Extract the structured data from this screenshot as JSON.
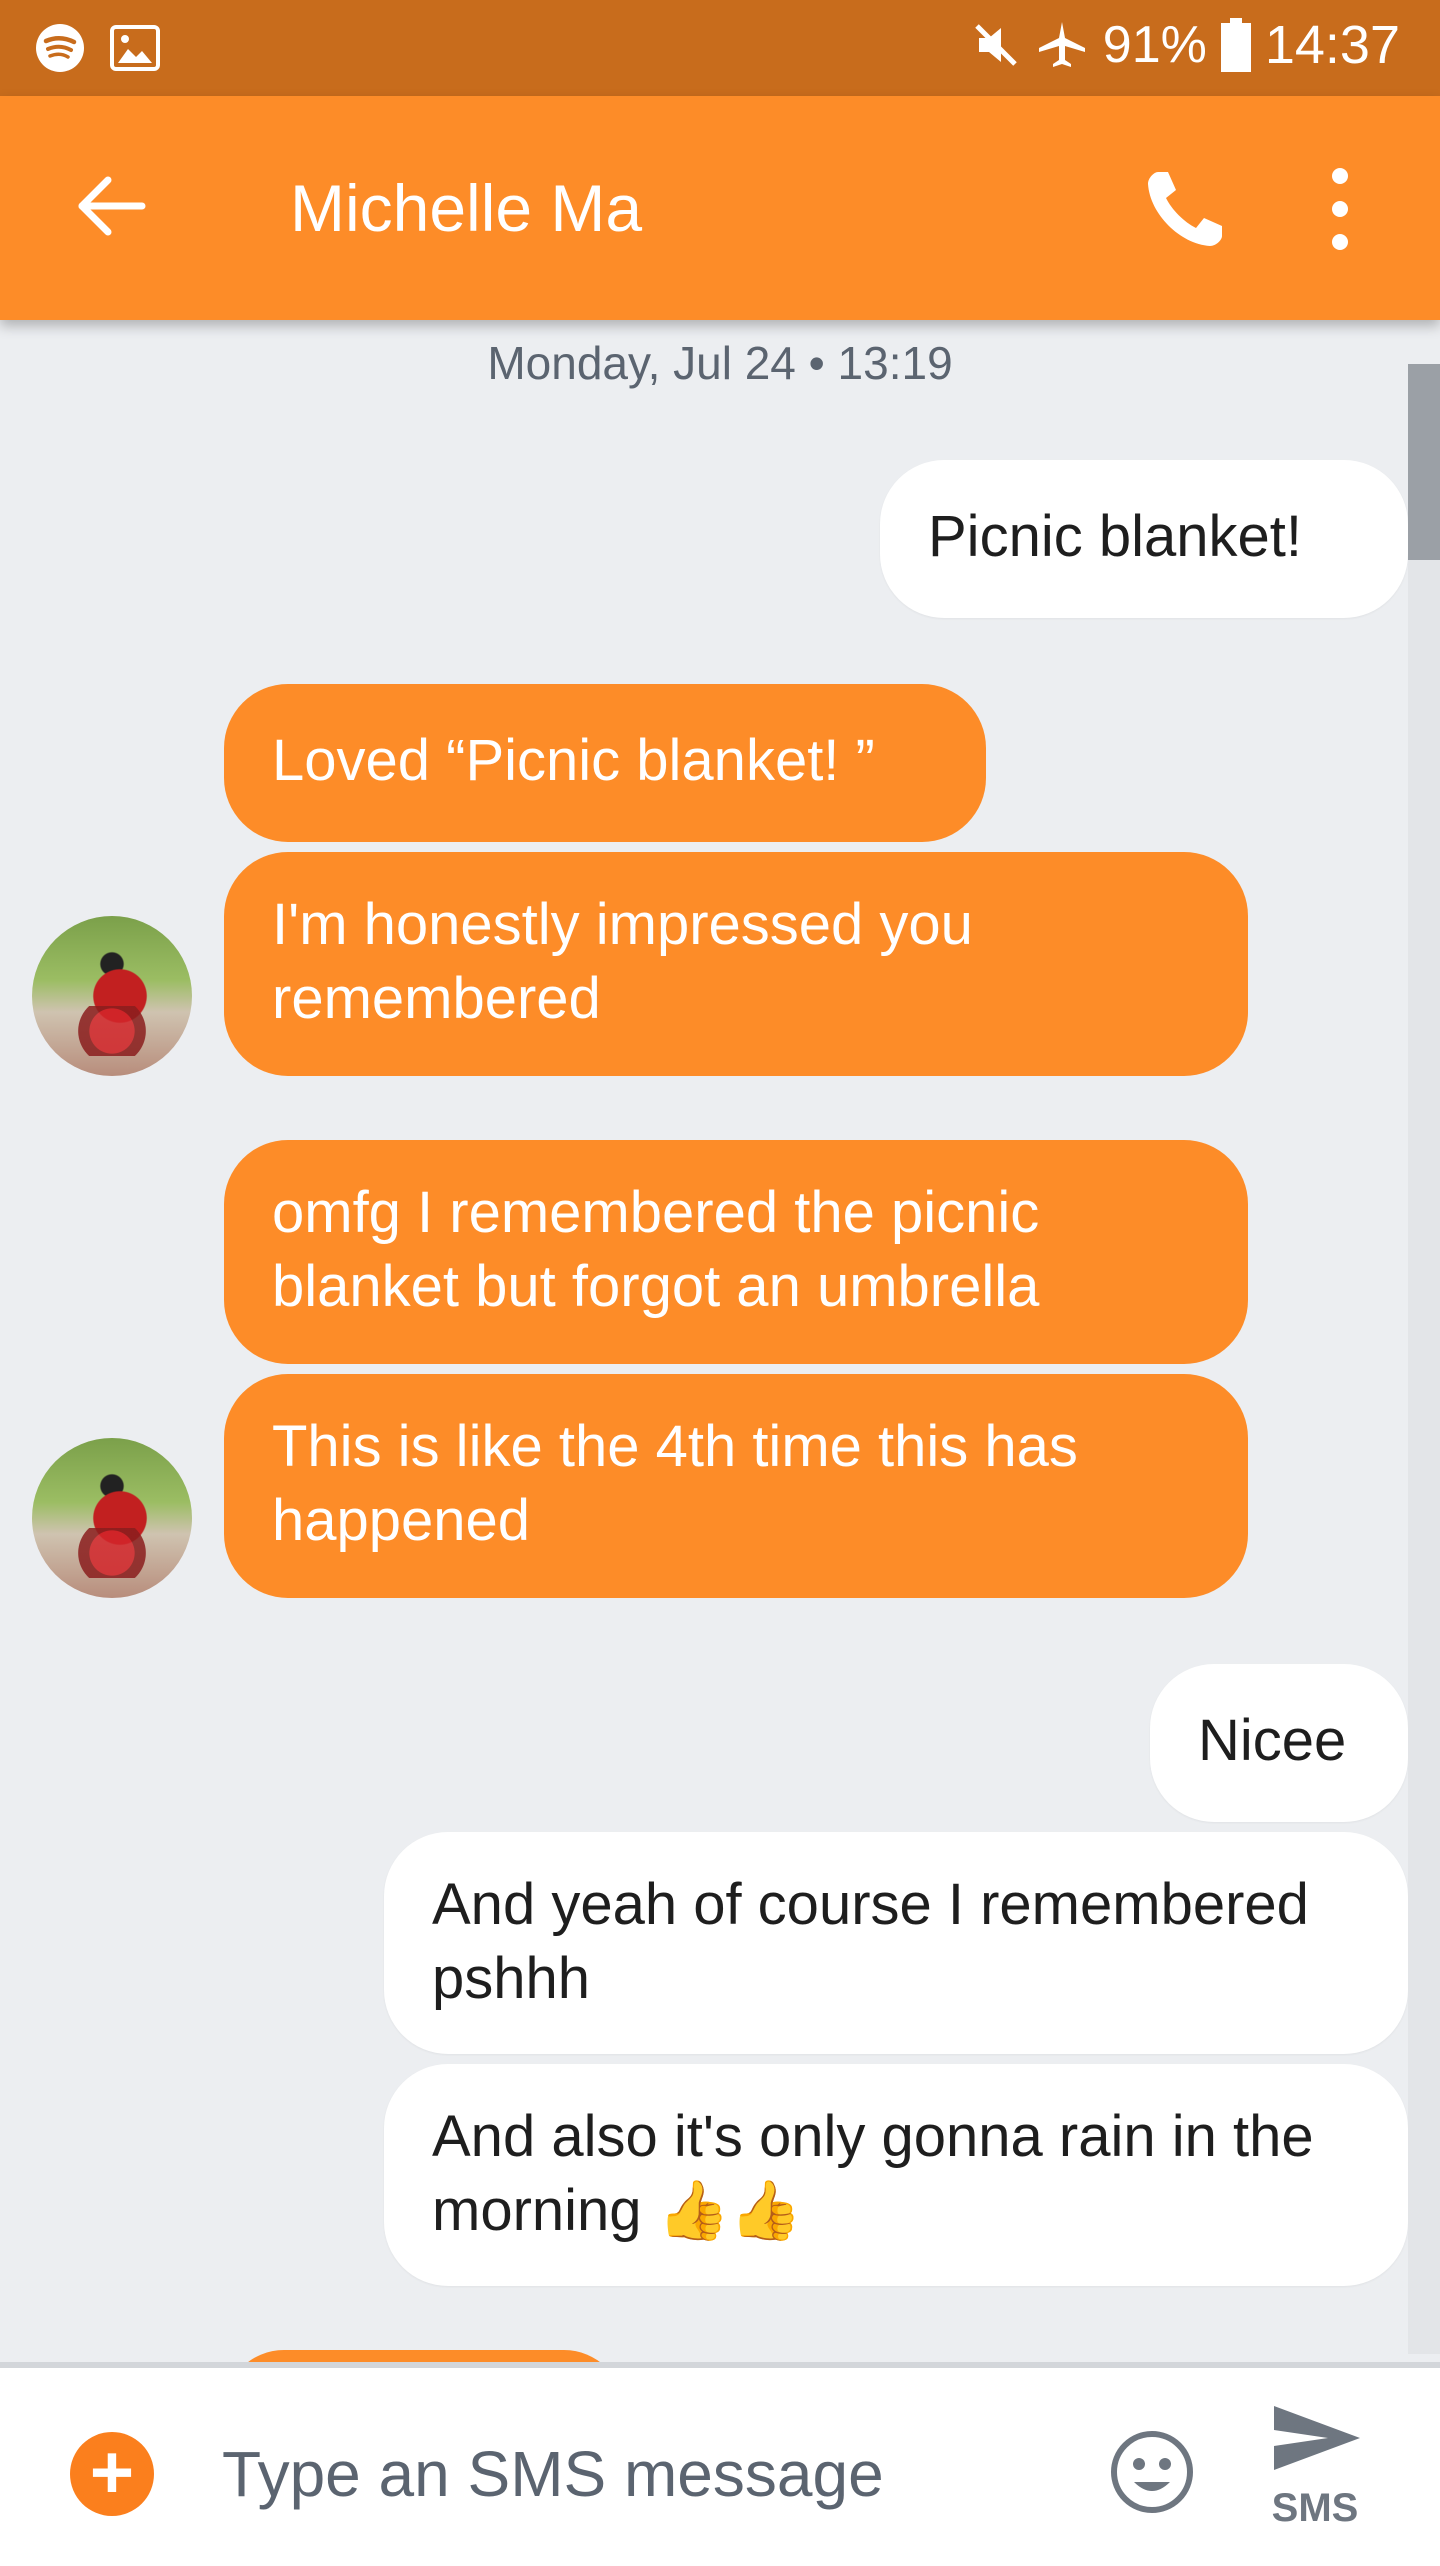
{
  "status_bar": {
    "battery_percent": "91%",
    "time": "14:37",
    "icons": [
      "spotify-icon",
      "image-icon",
      "mute-icon",
      "airplane-icon",
      "battery-icon"
    ]
  },
  "header": {
    "contact_name": "Michelle Ma",
    "back_icon": "arrow-left-icon",
    "call_icon": "phone-icon",
    "menu_icon": "more-vert-icon"
  },
  "conversation": {
    "timestamp": "Monday, Jul 24 • 13:19",
    "messages": [
      {
        "direction": "out",
        "text": "Picnic blanket!"
      },
      {
        "direction": "in",
        "text": "Loved “Picnic blanket! ”"
      },
      {
        "direction": "in",
        "text": "I'm honestly impressed you remembered"
      },
      {
        "direction": "in",
        "text": "omfg I remembered the picnic blanket but forgot an umbrella"
      },
      {
        "direction": "in",
        "text": "This is like the 4th time this has happened"
      },
      {
        "direction": "out",
        "text": "Nicee"
      },
      {
        "direction": "out",
        "text": "And yeah of course I remembered pshhh"
      },
      {
        "direction": "out",
        "text": "And also it's only gonna rain in the morning 👍👍"
      }
    ]
  },
  "composer": {
    "placeholder": "Type an SMS message",
    "send_label": "SMS",
    "attach_icon": "plus-icon",
    "emoji_icon": "emoji-icon",
    "send_icon": "send-icon"
  },
  "colors": {
    "status_bar": "#c86c1c",
    "app_bar": "#fd8c28",
    "incoming_bubble": "#fd8c28",
    "outgoing_bubble": "#ffffff",
    "background": "#eceef1"
  }
}
